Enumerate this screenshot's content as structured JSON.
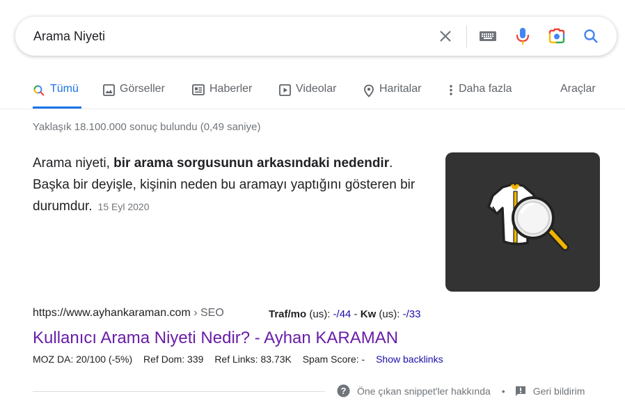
{
  "search": {
    "query": "Arama Niyeti"
  },
  "tabs": [
    {
      "label": "Tümü",
      "icon": "search-icon",
      "active": true
    },
    {
      "label": "Görseller",
      "icon": "image-icon"
    },
    {
      "label": "Haberler",
      "icon": "news-icon"
    },
    {
      "label": "Videolar",
      "icon": "video-icon"
    },
    {
      "label": "Haritalar",
      "icon": "map-pin-icon"
    },
    {
      "label": "Daha fazla",
      "icon": "more-vert-icon"
    }
  ],
  "tools_label": "Araçlar",
  "result_stats": "Yaklaşık 18.100.000 sonuç bulundu (0,49 saniye)",
  "featured_snippet": {
    "text_before": "Arama niyeti, ",
    "text_bold": "bir arama sorgusunun arkasındaki nedendir",
    "text_after": ". Başka bir deyişle, kişinin neden bu aramayı yaptığını gösteren bir durumdur.",
    "date": "15 Eyl 2020"
  },
  "result": {
    "url": "https://www.ayhankaraman.com",
    "breadcrumb": " › SEO",
    "traffic_label": "Traf/mo",
    "traffic_region": " (us): ",
    "traffic_value": "-/44",
    "sep": " - ",
    "kw_label": "Kw",
    "kw_region": " (us): ",
    "kw_value": "-/33",
    "title": "Kullanıcı Arama Niyeti Nedir? - Ayhan KARAMAN",
    "moz_da": "MOZ DA: 20/100 (-5%)",
    "ref_dom": "Ref Dom: 339",
    "ref_links": "Ref Links: 83.73K",
    "spam_score": "Spam Score: -",
    "backlinks": "Show backlinks"
  },
  "footer": {
    "about_snippets": "Öne çıkan snippet'ler hakkında",
    "bullet": "•",
    "feedback": "Geri bildirim"
  },
  "colors": {
    "accent": "#1a73e8",
    "visited_link": "#681da8",
    "link": "#1a0dab"
  }
}
